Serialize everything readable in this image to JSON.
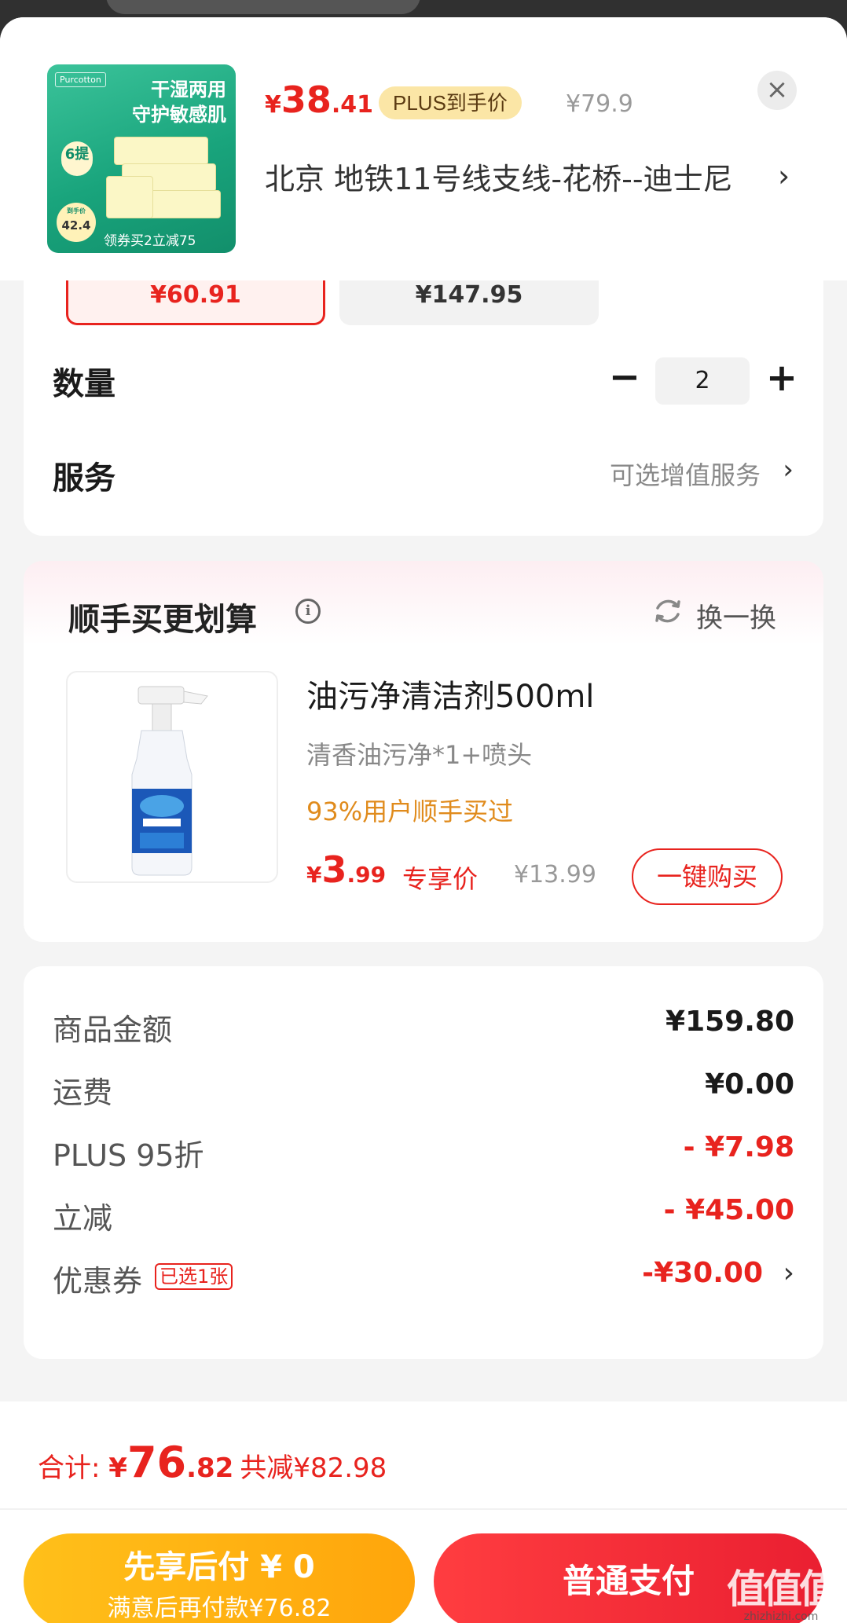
{
  "header": {
    "thumbnail": {
      "brand": "Purcotton",
      "line1": "干湿两用",
      "line2": "守护敏感肌",
      "badge": "6提",
      "price_badge_note": "到手价",
      "price_badge": "42.4",
      "strip": "领券买2立减75"
    },
    "price_symbol": "¥",
    "price_int": "38",
    "price_dec": ".41",
    "plus_tag": "PLUS到手价",
    "original_price": "¥79.9",
    "close_icon": "×",
    "address": "北京  地铁11号线支线-花桥--迪士尼",
    "address_chevron": "›"
  },
  "spec": {
    "option_selected": "¥60.91",
    "option_other": "¥147.95",
    "quantity_label": "数量",
    "quantity_minus": "−",
    "quantity_value": "2",
    "quantity_plus": "+",
    "service_label": "服务",
    "service_value": "可选增值服务",
    "service_chevron": "›"
  },
  "bundle": {
    "title": "顺手买更划算",
    "info_icon": "i",
    "swap_label": "换一换",
    "product_name": "油污净清洁剂500ml",
    "product_sub": "清香油污净*1+喷头",
    "product_note": "93%用户顺手买过",
    "price_symbol": "¥",
    "price_int": "3",
    "price_dec": ".99",
    "price_tag": "专享价",
    "original_price": "¥13.99",
    "buy_button": "一键购买"
  },
  "summary": {
    "rows": [
      {
        "label": "商品金额",
        "value": "¥159.80"
      },
      {
        "label": "运费",
        "value": "¥0.00"
      },
      {
        "label": "PLUS 95折",
        "value": "- ¥7.98"
      },
      {
        "label": "立减",
        "value": "- ¥45.00"
      }
    ],
    "coupon_label": "优惠券",
    "coupon_tag": "已选1张",
    "coupon_value": "-¥30.00",
    "coupon_chevron": "›"
  },
  "footer": {
    "total_label": "合计: ",
    "total_symbol": "¥",
    "total_int": "76",
    "total_dec": ".82",
    "saved": "共减¥82.98",
    "pay_later_line1": "先享后付 ¥ 0",
    "pay_later_line2": "满意后再付款¥76.82",
    "pay_normal": "普通支付",
    "watermark": "值值值",
    "watermark_url": "zhizhizhi.com"
  },
  "colors": {
    "accent_red": "#e8231e",
    "plus_gold": "#fbe6a6",
    "note_orange": "#e08b1c",
    "pay_later_yellow": "#ffb514"
  },
  "icons": [
    "close-icon",
    "chevron-right-icon",
    "info-icon",
    "refresh-icon",
    "minus-icon",
    "plus-icon"
  ]
}
